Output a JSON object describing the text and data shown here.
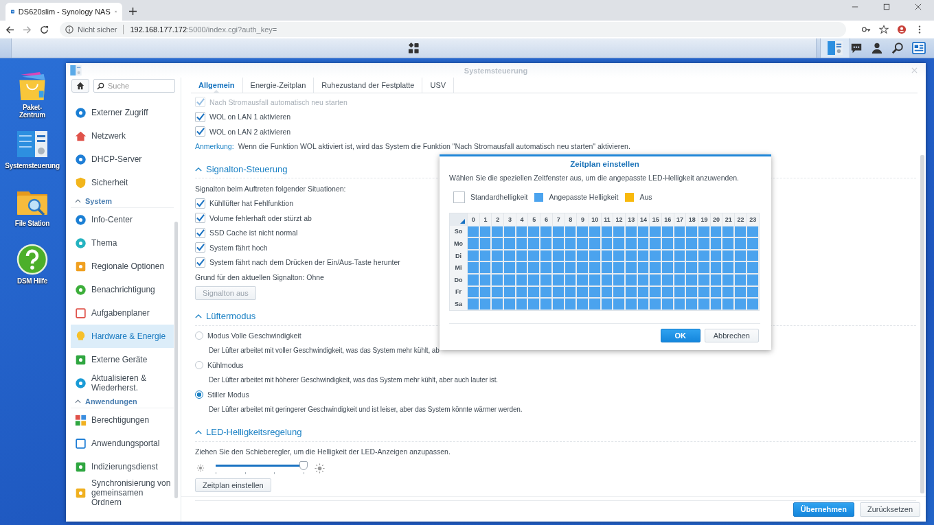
{
  "browser": {
    "tab_title": "DS620slim - Synology NAS",
    "security": "Nicht sicher",
    "url_host": "192.168.177.172",
    "url_rest": ":5000/index.cgi?auth_key="
  },
  "desktop_icons": [
    {
      "lines": [
        "Paket-",
        "Zentrum"
      ]
    },
    {
      "lines": [
        "Systemsteuerung"
      ]
    },
    {
      "lines": [
        "File Station"
      ]
    },
    {
      "lines": [
        "DSM Hilfe"
      ]
    }
  ],
  "window": {
    "title": "Systemsteuerung"
  },
  "sidebar": {
    "search_placeholder": "Suche",
    "items": [
      {
        "kind": "item",
        "label": "Externer Zugriff",
        "selected": false
      },
      {
        "kind": "item",
        "label": "Netzwerk",
        "selected": false
      },
      {
        "kind": "item",
        "label": "DHCP-Server",
        "selected": false
      },
      {
        "kind": "item",
        "label": "Sicherheit",
        "selected": false
      },
      {
        "kind": "header",
        "label": "System",
        "expanded": true
      },
      {
        "kind": "item",
        "label": "Info-Center",
        "selected": false
      },
      {
        "kind": "item",
        "label": "Thema",
        "selected": false
      },
      {
        "kind": "item",
        "label": "Regionale Optionen",
        "selected": false
      },
      {
        "kind": "item",
        "label": "Benachrichtigung",
        "selected": false
      },
      {
        "kind": "item",
        "label": "Aufgabenplaner",
        "selected": false
      },
      {
        "kind": "item",
        "label": "Hardware & Energie",
        "selected": true
      },
      {
        "kind": "item",
        "label": "Externe Geräte",
        "selected": false
      },
      {
        "kind": "item",
        "label": "Aktualisieren & Wiederherst.",
        "selected": false
      },
      {
        "kind": "header",
        "label": "Anwendungen",
        "expanded": true
      },
      {
        "kind": "item",
        "label": "Berechtigungen",
        "selected": false
      },
      {
        "kind": "item",
        "label": "Anwendungsportal",
        "selected": false
      },
      {
        "kind": "item",
        "label": "Indizierungsdienst",
        "selected": false
      },
      {
        "kind": "item",
        "label": "Synchronisierung von gemeinsamen Ordnern",
        "selected": false
      }
    ]
  },
  "tabs": [
    {
      "label": "Allgemein",
      "selected": true
    },
    {
      "label": "Energie-Zeitplan",
      "selected": false
    },
    {
      "label": "Ruhezustand der Festplatte",
      "selected": false
    },
    {
      "label": "USV",
      "selected": false
    }
  ],
  "top_options": [
    {
      "label": "Nach Stromausfall automatisch neu starten",
      "checked": true,
      "disabled": true
    },
    {
      "label": "WOL on LAN 1 aktivieren",
      "checked": true,
      "disabled": false
    },
    {
      "label": "WOL on LAN 2 aktivieren",
      "checked": true,
      "disabled": false
    }
  ],
  "note": {
    "label": "Anmerkung:",
    "text": "Wenn die Funktion WOL aktiviert ist, wird das System die Funktion \"Nach Stromausfall automatisch neu starten\" aktivieren."
  },
  "sections": [
    {
      "kind": "checks",
      "title": "Signalton-Steuerung",
      "expanded": true,
      "intro": "Signalton beim Auftreten folgender Situationen:",
      "options": [
        {
          "label": "Kühllüfter hat Fehlfunktion",
          "checked": true
        },
        {
          "label": "Volume fehlerhaft oder stürzt ab",
          "checked": true
        },
        {
          "label": "SSD Cache ist nicht normal",
          "checked": true
        },
        {
          "label": "System fährt hoch",
          "checked": true
        },
        {
          "label": "System fährt nach dem Drücken der Ein/Aus-Taste herunter",
          "checked": true
        }
      ],
      "status": "Grund für den aktuellen Signalton: Ohne",
      "button": {
        "label": "Signalton aus",
        "disabled": true
      }
    },
    {
      "kind": "radios",
      "title": "Lüftermodus",
      "expanded": true,
      "options": [
        {
          "label": "Modus Volle Geschwindigkeit",
          "description": "Der Lüfter arbeitet mit voller Geschwindigkeit, was das System mehr kühlt, ab",
          "selected": false
        },
        {
          "label": "Kühlmodus",
          "description": "Der Lüfter arbeitet mit höherer Geschwindigkeit, was das System mehr kühlt, aber auch lauter ist.",
          "selected": false
        },
        {
          "label": "Stiller Modus",
          "description": "Der Lüfter arbeitet mit geringerer Geschwindigkeit und ist leiser, aber das System könnte wärmer werden.",
          "selected": true
        }
      ]
    },
    {
      "kind": "slider",
      "title": "LED-Helligkeitsregelung",
      "expanded": true,
      "intro": "Ziehen Sie den Schieberegler, um die Helligkeit der LED-Anzeigen anzupassen.",
      "level": 1,
      "button": {
        "label": "Zeitplan einstellen",
        "disabled": false
      }
    }
  ],
  "footer_buttons": [
    {
      "label": "Übernehmen",
      "primary": true
    },
    {
      "label": "Zurücksetzen",
      "primary": false
    }
  ],
  "dialog": {
    "title": "Zeitplan einstellen",
    "description": "Wählen Sie die speziellen Zeitfenster aus, um die angepasste LED-Helligkeit anzuwenden.",
    "legend": [
      {
        "kind": "standard",
        "label": "Standardhelligkeit",
        "color": "#ffffff"
      },
      {
        "kind": "custom",
        "label": "Angepasste Helligkeit",
        "color": "#4ba3ee"
      },
      {
        "kind": "off",
        "label": "Aus",
        "color": "#f8b90c"
      }
    ],
    "hours": [
      "0",
      "1",
      "2",
      "3",
      "4",
      "5",
      "6",
      "7",
      "8",
      "9",
      "10",
      "11",
      "12",
      "13",
      "14",
      "15",
      "16",
      "17",
      "18",
      "19",
      "20",
      "21",
      "22",
      "23"
    ],
    "days": [
      {
        "label": "So",
        "slots": [
          {
            "selected": true
          },
          {
            "selected": true
          },
          {
            "selected": true
          },
          {
            "selected": true
          },
          {
            "selected": true
          },
          {
            "selected": true
          },
          {
            "selected": true
          },
          {
            "selected": true
          },
          {
            "selected": true
          },
          {
            "selected": true
          },
          {
            "selected": true
          },
          {
            "selected": true
          },
          {
            "selected": true
          },
          {
            "selected": true
          },
          {
            "selected": true
          },
          {
            "selected": true
          },
          {
            "selected": true
          },
          {
            "selected": true
          },
          {
            "selected": true
          },
          {
            "selected": true
          },
          {
            "selected": true
          },
          {
            "selected": true
          },
          {
            "selected": true
          },
          {
            "selected": true
          }
        ]
      },
      {
        "label": "Mo",
        "slots": [
          {
            "selected": true
          },
          {
            "selected": true
          },
          {
            "selected": true
          },
          {
            "selected": true
          },
          {
            "selected": true
          },
          {
            "selected": true
          },
          {
            "selected": true
          },
          {
            "selected": true
          },
          {
            "selected": true
          },
          {
            "selected": true
          },
          {
            "selected": true
          },
          {
            "selected": true
          },
          {
            "selected": true
          },
          {
            "selected": true
          },
          {
            "selected": true
          },
          {
            "selected": true
          },
          {
            "selected": true
          },
          {
            "selected": true
          },
          {
            "selected": true
          },
          {
            "selected": true
          },
          {
            "selected": true
          },
          {
            "selected": true
          },
          {
            "selected": true
          },
          {
            "selected": true
          }
        ]
      },
      {
        "label": "Di",
        "slots": [
          {
            "selected": true
          },
          {
            "selected": true
          },
          {
            "selected": true
          },
          {
            "selected": true
          },
          {
            "selected": true
          },
          {
            "selected": true
          },
          {
            "selected": true
          },
          {
            "selected": true
          },
          {
            "selected": true
          },
          {
            "selected": true
          },
          {
            "selected": true
          },
          {
            "selected": true
          },
          {
            "selected": true
          },
          {
            "selected": true
          },
          {
            "selected": true
          },
          {
            "selected": true
          },
          {
            "selected": true
          },
          {
            "selected": true
          },
          {
            "selected": true
          },
          {
            "selected": true
          },
          {
            "selected": true
          },
          {
            "selected": true
          },
          {
            "selected": true
          },
          {
            "selected": true
          }
        ]
      },
      {
        "label": "Mi",
        "slots": [
          {
            "selected": true
          },
          {
            "selected": true
          },
          {
            "selected": true
          },
          {
            "selected": true
          },
          {
            "selected": true
          },
          {
            "selected": true
          },
          {
            "selected": true
          },
          {
            "selected": true
          },
          {
            "selected": true
          },
          {
            "selected": true
          },
          {
            "selected": true
          },
          {
            "selected": true
          },
          {
            "selected": true
          },
          {
            "selected": true
          },
          {
            "selected": true
          },
          {
            "selected": true
          },
          {
            "selected": true
          },
          {
            "selected": true
          },
          {
            "selected": true
          },
          {
            "selected": true
          },
          {
            "selected": true
          },
          {
            "selected": true
          },
          {
            "selected": true
          },
          {
            "selected": true
          }
        ]
      },
      {
        "label": "Do",
        "slots": [
          {
            "selected": true
          },
          {
            "selected": true
          },
          {
            "selected": true
          },
          {
            "selected": true
          },
          {
            "selected": true
          },
          {
            "selected": true
          },
          {
            "selected": true
          },
          {
            "selected": true
          },
          {
            "selected": true
          },
          {
            "selected": true
          },
          {
            "selected": true
          },
          {
            "selected": true
          },
          {
            "selected": true
          },
          {
            "selected": true
          },
          {
            "selected": true
          },
          {
            "selected": true
          },
          {
            "selected": true
          },
          {
            "selected": true
          },
          {
            "selected": true
          },
          {
            "selected": true
          },
          {
            "selected": true
          },
          {
            "selected": true
          },
          {
            "selected": true
          },
          {
            "selected": true
          }
        ]
      },
      {
        "label": "Fr",
        "slots": [
          {
            "selected": true
          },
          {
            "selected": true
          },
          {
            "selected": true
          },
          {
            "selected": true
          },
          {
            "selected": true
          },
          {
            "selected": true
          },
          {
            "selected": true
          },
          {
            "selected": true
          },
          {
            "selected": true
          },
          {
            "selected": true
          },
          {
            "selected": true
          },
          {
            "selected": true
          },
          {
            "selected": true
          },
          {
            "selected": true
          },
          {
            "selected": true
          },
          {
            "selected": true
          },
          {
            "selected": true
          },
          {
            "selected": true
          },
          {
            "selected": true
          },
          {
            "selected": true
          },
          {
            "selected": true
          },
          {
            "selected": true
          },
          {
            "selected": true
          },
          {
            "selected": true
          }
        ]
      },
      {
        "label": "Sa",
        "slots": [
          {
            "selected": true
          },
          {
            "selected": true
          },
          {
            "selected": true
          },
          {
            "selected": true
          },
          {
            "selected": true
          },
          {
            "selected": true
          },
          {
            "selected": true
          },
          {
            "selected": true
          },
          {
            "selected": true
          },
          {
            "selected": true
          },
          {
            "selected": true
          },
          {
            "selected": true
          },
          {
            "selected": true
          },
          {
            "selected": true
          },
          {
            "selected": true
          },
          {
            "selected": true
          },
          {
            "selected": true
          },
          {
            "selected": true
          },
          {
            "selected": true
          },
          {
            "selected": true
          },
          {
            "selected": true
          },
          {
            "selected": true
          },
          {
            "selected": true
          },
          {
            "selected": true
          }
        ]
      }
    ],
    "buttons": [
      {
        "label": "OK",
        "primary": true
      },
      {
        "label": "Abbrechen",
        "primary": false
      }
    ]
  }
}
